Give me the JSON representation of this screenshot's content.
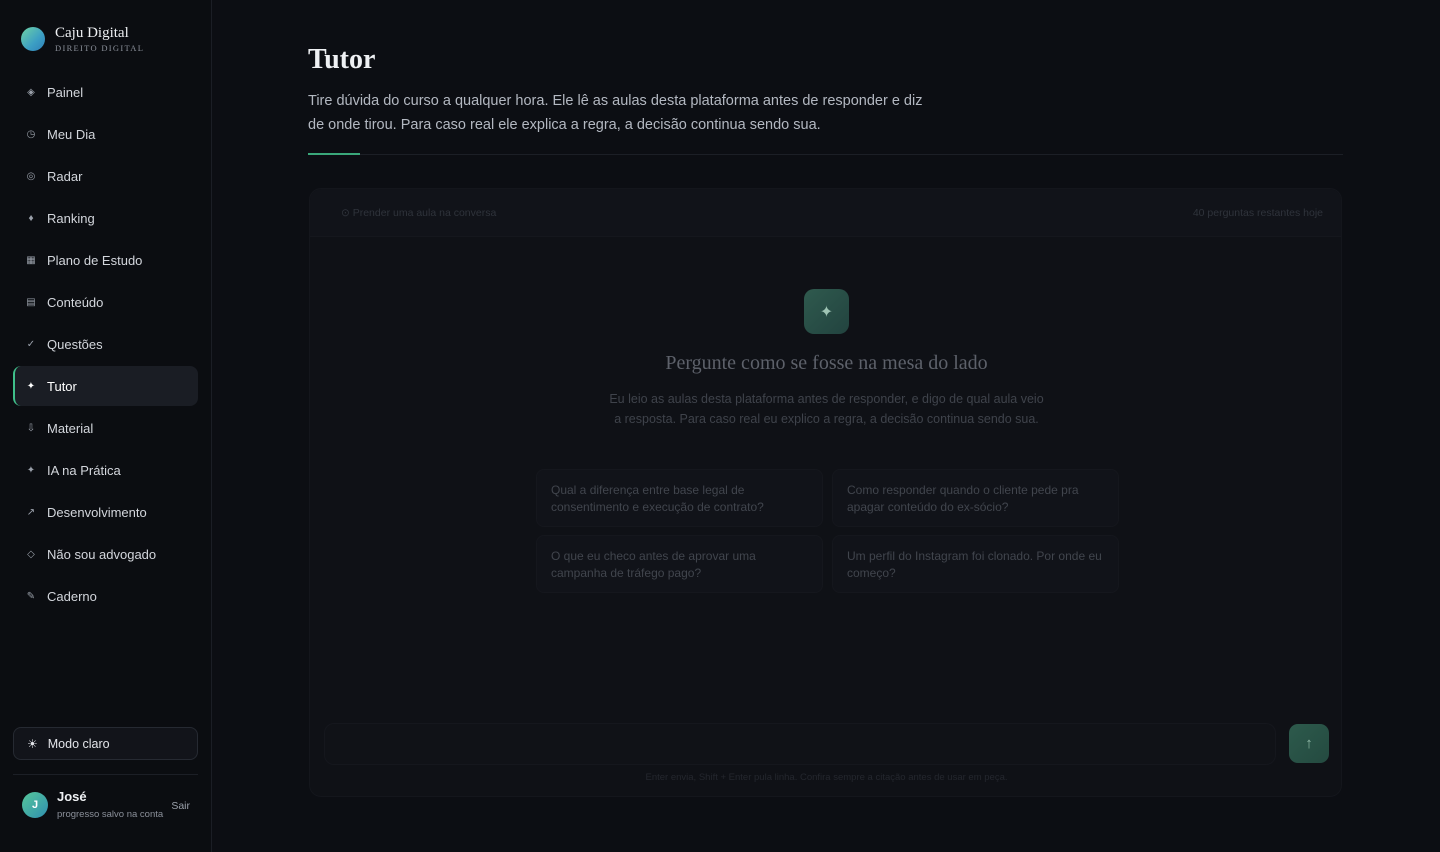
{
  "brand": {
    "name": "Caju Digital",
    "subtitle": "DIREITO DIGITAL"
  },
  "sidebar": {
    "items": [
      {
        "label": "Painel",
        "icon": "◈"
      },
      {
        "label": "Meu Dia",
        "icon": "◷"
      },
      {
        "label": "Radar",
        "icon": "◎"
      },
      {
        "label": "Ranking",
        "icon": "♦"
      },
      {
        "label": "Plano de Estudo",
        "icon": "▦"
      },
      {
        "label": "Conteúdo",
        "icon": "▤"
      },
      {
        "label": "Questões",
        "icon": "✓"
      },
      {
        "label": "Tutor",
        "icon": "✦"
      },
      {
        "label": "Material",
        "icon": "⇩"
      },
      {
        "label": "IA na Prática",
        "icon": "✦"
      },
      {
        "label": "Desenvolvimento",
        "icon": "↗"
      },
      {
        "label": "Não sou advogado",
        "icon": "◇"
      },
      {
        "label": "Caderno",
        "icon": "✎"
      }
    ],
    "active_item": "Tutor",
    "theme_toggle": {
      "label": "Modo claro",
      "icon": "☀"
    },
    "user": {
      "initial": "J",
      "name": "José",
      "status": "progresso salvo na conta",
      "logout_label": "Sair"
    }
  },
  "main": {
    "title": "Tutor",
    "description": "Tire dúvida do curso a qualquer hora. Ele lê as aulas desta plataforma antes de responder e diz de onde tirou. Para caso real ele explica a regra, a decisão continua sendo sua."
  },
  "chat": {
    "pin_lesson_label": "⊙ Prender uma aula na conversa",
    "remaining_label": "40 perguntas restantes hoje",
    "empty_state": {
      "icon": "✦",
      "title": "Pergunte como se fosse na mesa do lado",
      "description": "Eu leio as aulas desta plataforma antes de responder, e digo de qual aula veio a resposta. Para caso real eu explico a regra, a decisão continua sendo sua."
    },
    "suggestions": [
      "Qual a diferença entre base legal de consentimento e execução de contrato?",
      "Como responder quando o cliente pede pra apagar conteúdo do ex-sócio?",
      "O que eu checo antes de aprovar uma campanha de tráfego pago?",
      "Um perfil do Instagram foi clonado. Por onde eu começo?"
    ],
    "input": {
      "value": "",
      "placeholder": ""
    },
    "send_icon": "↑",
    "hint": "Enter envia, Shift + Enter pula linha. Confira sempre a citação antes de usar em peça."
  },
  "colors": {
    "accent": "#3aa77a",
    "background": "#0c0e13",
    "sidebar": "#0b0d11"
  }
}
